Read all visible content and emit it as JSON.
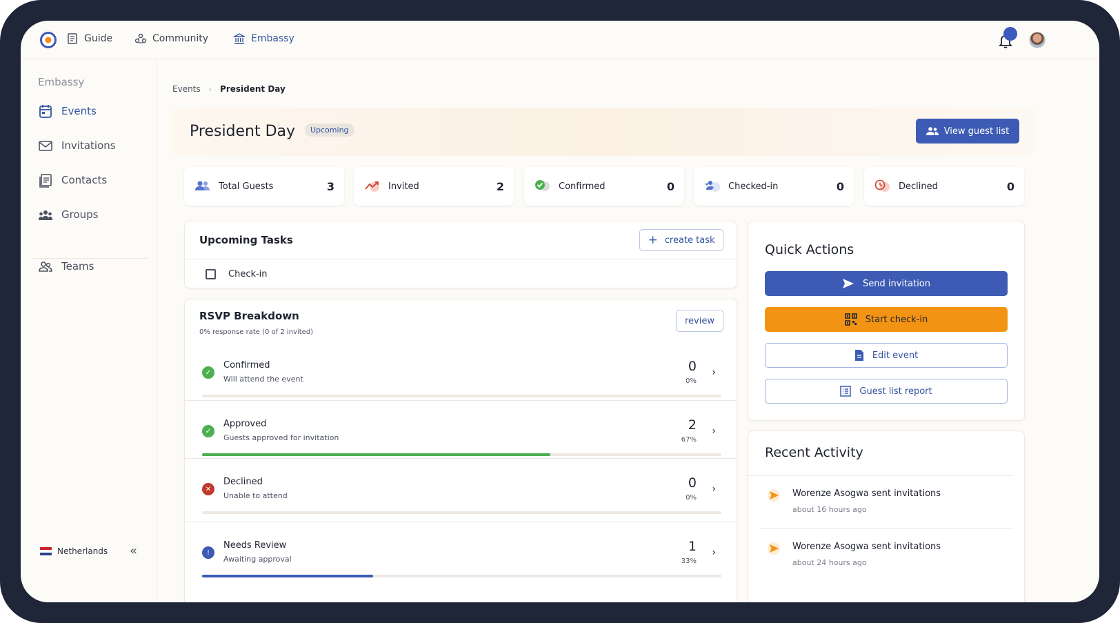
{
  "nav": {
    "items": [
      {
        "label": "Guide"
      },
      {
        "label": "Community"
      },
      {
        "label": "Embassy"
      }
    ]
  },
  "sidebar": {
    "title": "Embassy",
    "items": [
      {
        "label": "Events"
      },
      {
        "label": "Invitations"
      },
      {
        "label": "Contacts"
      },
      {
        "label": "Groups"
      },
      {
        "label": "Teams"
      }
    ],
    "country": "Netherlands",
    "collapse_glyph": "«"
  },
  "breadcrumb": {
    "parent": "Events",
    "separator": "›",
    "current": "President Day"
  },
  "event": {
    "title": "President Day",
    "status": "Upcoming",
    "view_guest_list": "View guest list"
  },
  "stats": [
    {
      "label": "Total Guests",
      "value": "3"
    },
    {
      "label": "Invited",
      "value": "2"
    },
    {
      "label": "Confirmed",
      "value": "0"
    },
    {
      "label": "Checked-in",
      "value": "0"
    },
    {
      "label": "Declined",
      "value": "0"
    }
  ],
  "tasks": {
    "title": "Upcoming Tasks",
    "create_label": "create task",
    "create_glyph": "+",
    "items": [
      {
        "label": "Check-in"
      }
    ]
  },
  "rsvp": {
    "title": "RSVP Breakdown",
    "subtitle": "0% response rate (0 of 2 invited)",
    "review_label": "review",
    "chevron": "›",
    "rows": [
      {
        "label": "Confirmed",
        "desc": "Will attend the event",
        "count": "0",
        "pct": "0%",
        "fraction": 0,
        "glyph": "✓",
        "color": "#4caf50"
      },
      {
        "label": "Approved",
        "desc": "Guests approved for invitation",
        "count": "2",
        "pct": "67%",
        "fraction": 0.67,
        "glyph": "✓",
        "color": "#4caf50"
      },
      {
        "label": "Declined",
        "desc": "Unable to attend",
        "count": "0",
        "pct": "0%",
        "fraction": 0,
        "glyph": "✕",
        "color": "#c0392b"
      },
      {
        "label": "Needs Review",
        "desc": "Awaiting approval",
        "count": "1",
        "pct": "33%",
        "fraction": 0.33,
        "glyph": "!",
        "color": "#3d5bb4"
      }
    ]
  },
  "quick_actions": {
    "title": "Quick Actions",
    "send": "Send invitation",
    "checkin": "Start check-in",
    "edit": "Edit event",
    "report": "Guest list report"
  },
  "recent": {
    "title": "Recent Activity",
    "items": [
      {
        "text": "Worenze Asogwa sent invitations",
        "time": "about 16 hours ago"
      },
      {
        "text": "Worenze Asogwa sent invitations",
        "time": "about 24 hours ago"
      }
    ]
  },
  "colors": {
    "accent": "#3d5bb4",
    "checkin": "#f39314",
    "progress_approved": "#4caf50",
    "progress_review": "#3d5bb4"
  }
}
